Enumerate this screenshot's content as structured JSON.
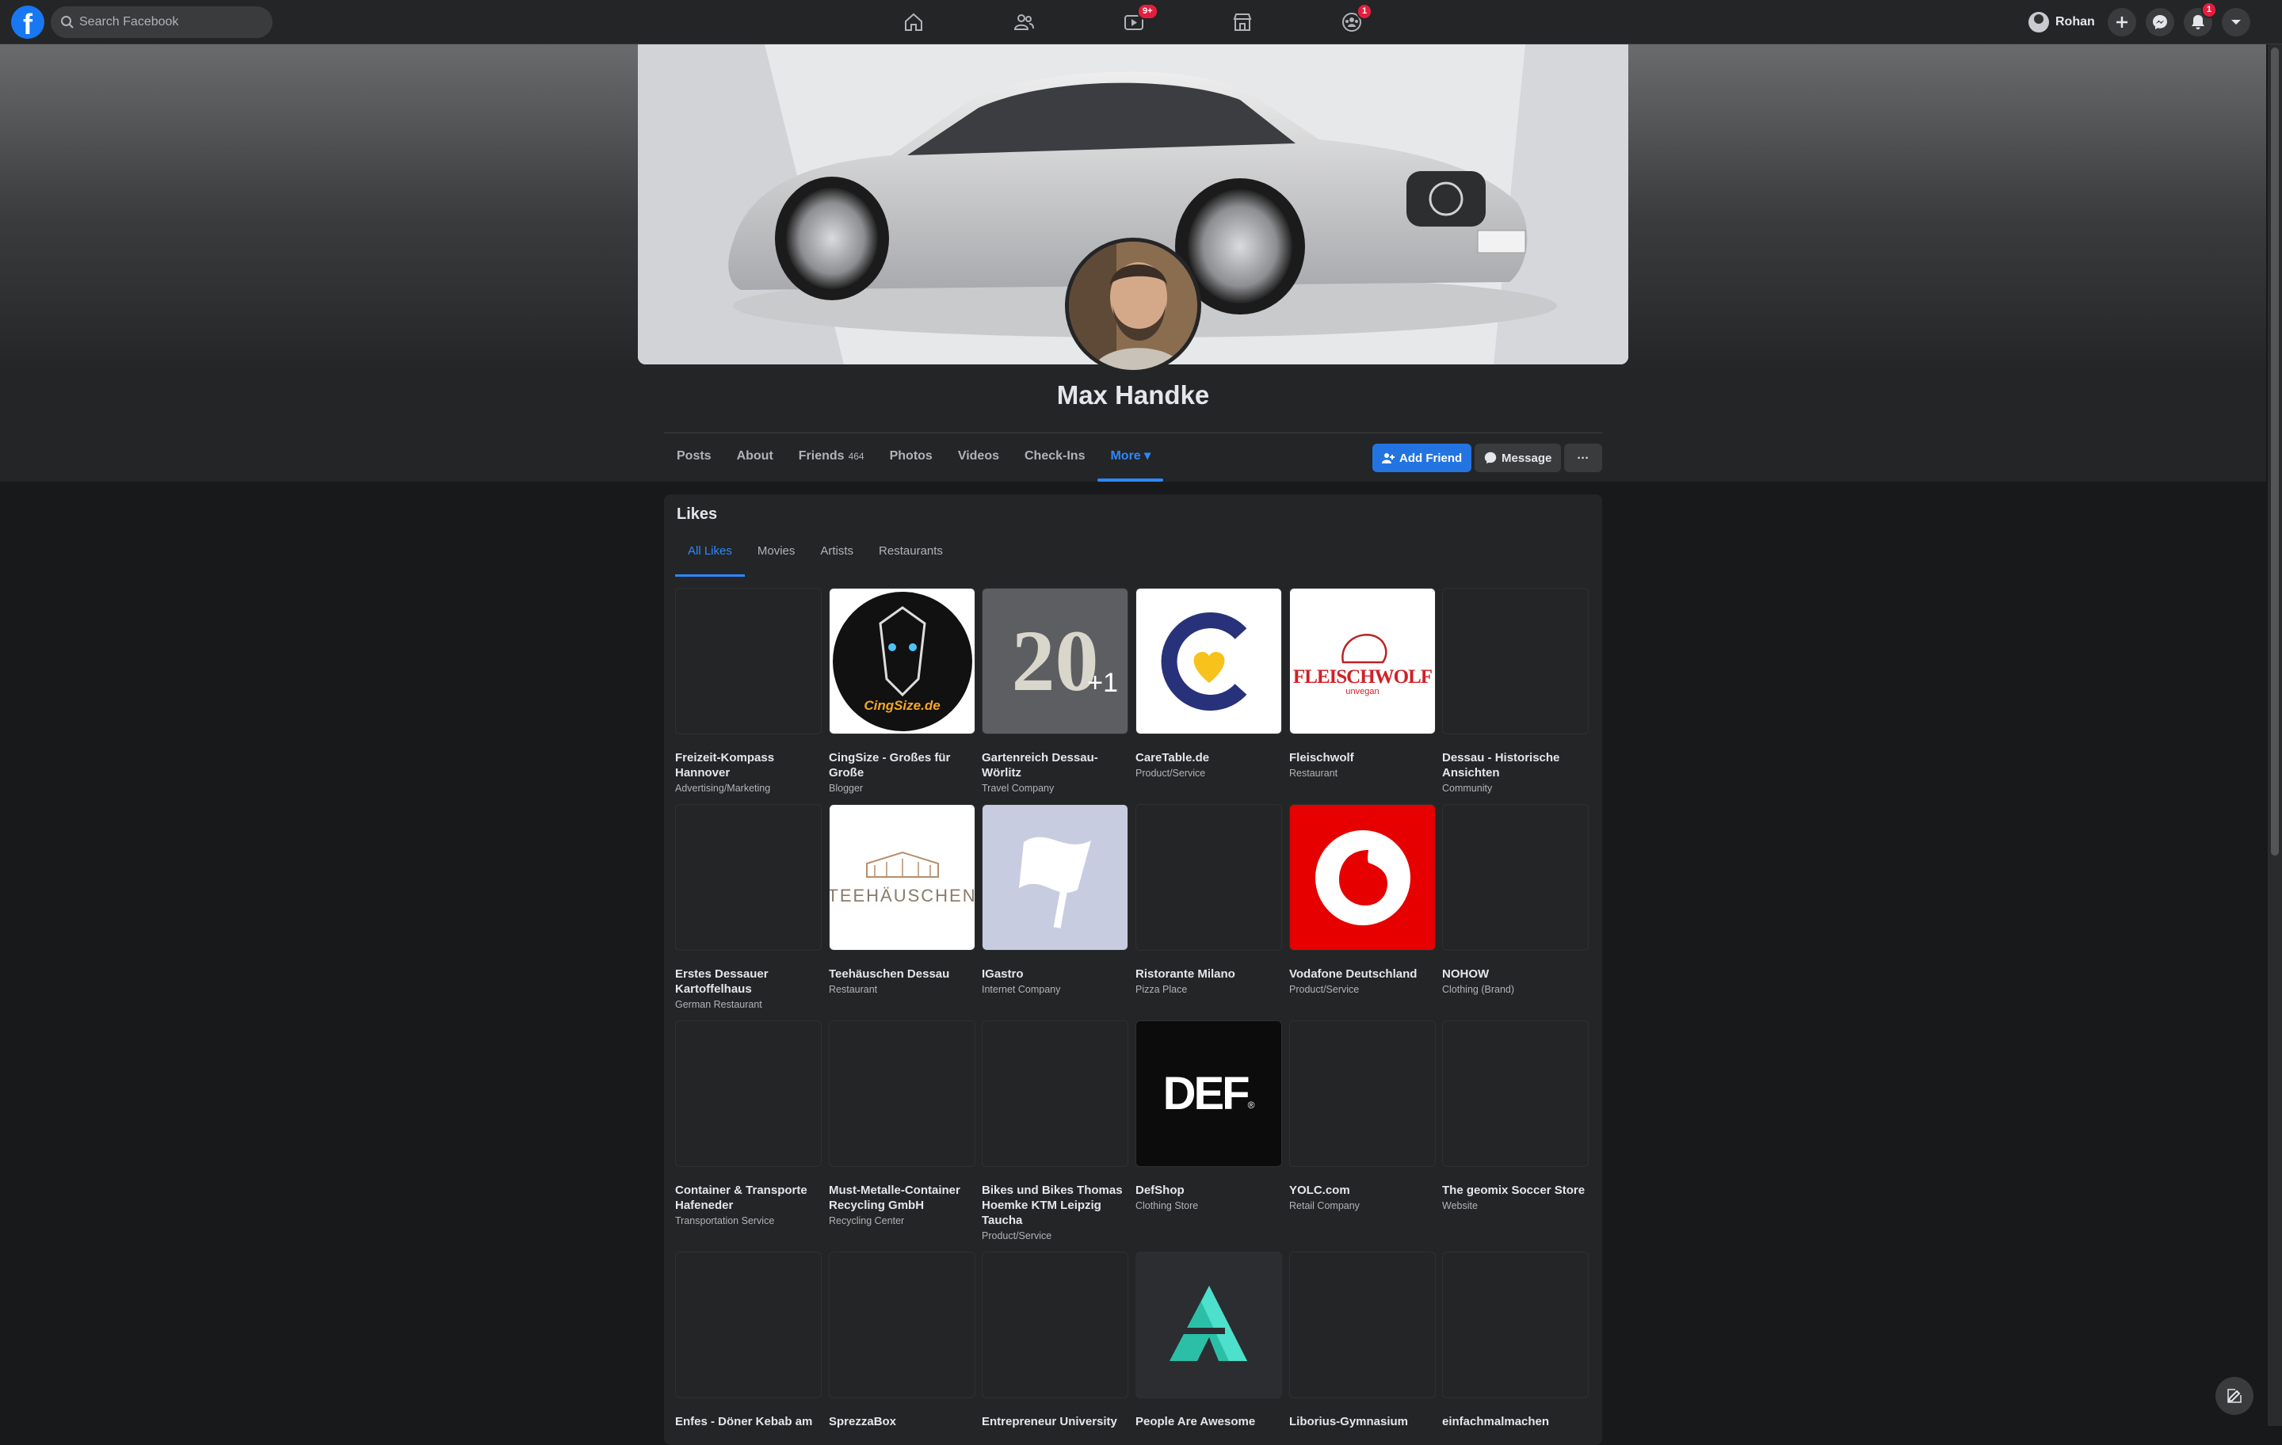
{
  "topbar": {
    "logo": "f",
    "search_placeholder": "Search Facebook",
    "nav": [
      {
        "name": "home-icon",
        "badge": ""
      },
      {
        "name": "friends-icon",
        "badge": ""
      },
      {
        "name": "watch-icon",
        "badge": "9+"
      },
      {
        "name": "marketplace-icon",
        "badge": ""
      },
      {
        "name": "groups-icon",
        "badge": "1"
      }
    ],
    "user_name": "Rohan",
    "notifications_badge": "1"
  },
  "profile": {
    "name": "Max Handke",
    "tabs": [
      {
        "label": "Posts",
        "count": ""
      },
      {
        "label": "About",
        "count": ""
      },
      {
        "label": "Friends",
        "count": "464"
      },
      {
        "label": "Photos",
        "count": ""
      },
      {
        "label": "Videos",
        "count": ""
      },
      {
        "label": "Check-Ins",
        "count": ""
      },
      {
        "label": "More ▾",
        "count": ""
      }
    ],
    "add_friend": "Add Friend",
    "message": "Message",
    "more_actions": "···"
  },
  "likes": {
    "title": "Likes",
    "tabs": [
      "All Likes",
      "Movies",
      "Artists",
      "Restaurants"
    ],
    "items": [
      {
        "name": "Freizeit-Kompass Hannover",
        "category": "Advertising/Marketing",
        "thumb": "blank"
      },
      {
        "name": "CingSize - Großes für Große",
        "category": "Blogger",
        "thumb": "cingsize",
        "thumb_text": "CingSize.de"
      },
      {
        "name": "Gartenreich Dessau-Wörlitz",
        "category": "Travel Company",
        "thumb": "garten",
        "thumb_text": "20",
        "thumb_text2": "+1"
      },
      {
        "name": "CareTable.de",
        "category": "Product/Service",
        "thumb": "caretable"
      },
      {
        "name": "Fleischwolf",
        "category": "Restaurant",
        "thumb": "fleisch",
        "thumb_text": "FLEISCHWOLF",
        "thumb_text2": "unvegan"
      },
      {
        "name": "Dessau - Historische Ansichten",
        "category": "Community",
        "thumb": "blank"
      },
      {
        "name": "Erstes Dessauer Kartoffelhaus",
        "category": "German Restaurant",
        "thumb": "blank"
      },
      {
        "name": "Teehäuschen Dessau",
        "category": "Restaurant",
        "thumb": "tee",
        "thumb_text": "TEEHÄUSCHEN"
      },
      {
        "name": "IGastro",
        "category": "Internet Company",
        "thumb": "flag"
      },
      {
        "name": "Ristorante Milano",
        "category": "Pizza Place",
        "thumb": "blank"
      },
      {
        "name": "Vodafone Deutschland",
        "category": "Product/Service",
        "thumb": "vodafone"
      },
      {
        "name": "NOHOW",
        "category": "Clothing (Brand)",
        "thumb": "blank"
      },
      {
        "name": "Container & Transporte Hafeneder",
        "category": "Transportation Service",
        "thumb": "blank"
      },
      {
        "name": "Must-Metalle-Container Recycling GmbH",
        "category": "Recycling Center",
        "thumb": "blank"
      },
      {
        "name": "Bikes und Bikes Thomas Hoemke KTM Leipzig Taucha",
        "category": "Product/Service",
        "thumb": "blank"
      },
      {
        "name": "DefShop",
        "category": "Clothing Store",
        "thumb": "def",
        "thumb_text": "DEF"
      },
      {
        "name": "YOLC.com",
        "category": "Retail Company",
        "thumb": "blank"
      },
      {
        "name": "The geomix Soccer Store",
        "category": "Website",
        "thumb": "blank"
      },
      {
        "name": "Enfes - Döner Kebab am",
        "category": "",
        "thumb": "blank"
      },
      {
        "name": "SprezzaBox",
        "category": "",
        "thumb": "blank"
      },
      {
        "name": "Entrepreneur University",
        "category": "",
        "thumb": "blank"
      },
      {
        "name": "People Are Awesome",
        "category": "",
        "thumb": "paa"
      },
      {
        "name": "Liborius-Gymnasium",
        "category": "",
        "thumb": "blank"
      },
      {
        "name": "einfachmalmachen",
        "category": "",
        "thumb": "blank"
      }
    ]
  },
  "colors": {
    "accent": "#2d88ff",
    "button_blue": "#2374e1",
    "background": "#18191a",
    "card": "#242526",
    "badge": "#e41e3f"
  }
}
